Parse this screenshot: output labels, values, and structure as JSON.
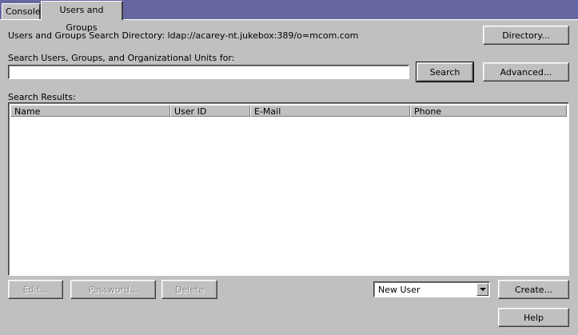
{
  "tabs": [
    {
      "label": "Console"
    },
    {
      "label": "Users and Groups"
    }
  ],
  "directory": {
    "label": "Users and Groups Search Directory: ldap://acarey-nt.jukebox:389/o=mcom.com",
    "button": "Directory..."
  },
  "search": {
    "label": "Search Users, Groups, and Organizational Units for:",
    "value": "",
    "search_button": "Search",
    "advanced_button": "Advanced..."
  },
  "results": {
    "label": "Search Results:",
    "columns": [
      "Name",
      "User ID",
      "E-Mail",
      "Phone"
    ]
  },
  "actions": {
    "edit": "Edit...",
    "password": "Password...",
    "delete": "Delete",
    "new_type_selected": "New User",
    "create": "Create...",
    "help": "Help"
  }
}
